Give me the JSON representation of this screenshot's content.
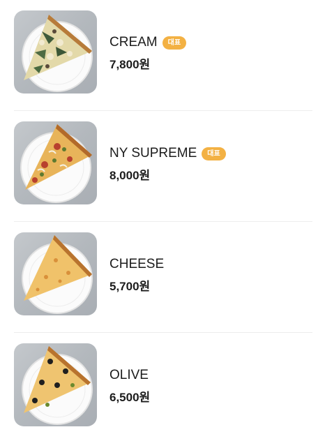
{
  "menu": {
    "items": [
      {
        "name": "CREAM",
        "badge": "대표",
        "price": "7,800원",
        "image_icon": "cream-pizza-slice"
      },
      {
        "name": "NY SUPREME",
        "badge": "대표",
        "price": "8,000원",
        "image_icon": "supreme-pizza-slice"
      },
      {
        "name": "CHEESE",
        "badge": "",
        "price": "5,700원",
        "image_icon": "cheese-pizza-slice"
      },
      {
        "name": "OLIVE",
        "badge": "",
        "price": "6,500원",
        "image_icon": "olive-pizza-slice"
      }
    ],
    "colors": {
      "badge": "#f3b143",
      "text": "#1c1c1c",
      "divider": "#ededed"
    }
  }
}
